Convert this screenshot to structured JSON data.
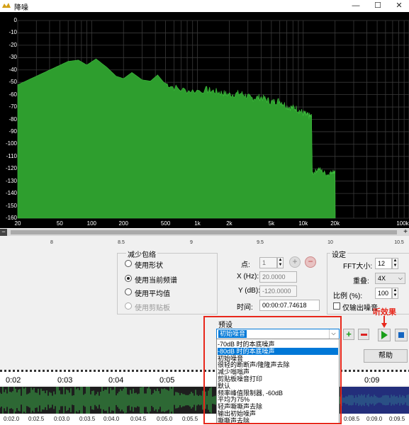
{
  "window": {
    "title": "降噪",
    "controls": [
      "—",
      "☐",
      "✕"
    ]
  },
  "spectrum": {
    "y_labels": [
      "0",
      "-10",
      "-20",
      "-30",
      "-40",
      "-50",
      "-60",
      "-70",
      "-80",
      "-90",
      "-100",
      "-110",
      "-120",
      "-130",
      "-140",
      "-150",
      "-160"
    ],
    "x_labels": [
      "20",
      "50",
      "100",
      "200",
      "500",
      "1k",
      "2k",
      "5k",
      "10k",
      "20k",
      "100k"
    ]
  },
  "ruler": {
    "labels": [
      "8",
      "8.5",
      "9",
      "9.5",
      "10",
      "10.5"
    ]
  },
  "envelope": {
    "title": "减少包络",
    "options": [
      {
        "label": "使用形状",
        "selected": false,
        "disabled": false
      },
      {
        "label": "使用当前频谱",
        "selected": true,
        "disabled": false
      },
      {
        "label": "使用平均值",
        "selected": false,
        "disabled": false
      },
      {
        "label": "使用剪贴板",
        "selected": false,
        "disabled": true
      }
    ]
  },
  "point": {
    "point_label": "点:",
    "point_value": "1",
    "x_label": "X (Hz):",
    "x_value": "20.0000",
    "y_label": "Y (dB):",
    "y_value": "-120.0000",
    "time_label": "时间:",
    "time_value": "00:00:07.74618"
  },
  "settings": {
    "title": "设定",
    "fft_label": "FFT大小:",
    "fft_value": "12",
    "overlap_label": "重叠:",
    "overlap_value": "4X",
    "ratio_label": "比例 (%):",
    "ratio_value": "100",
    "output_noise_label": "仅输出噪音"
  },
  "preset": {
    "title": "预设",
    "selected": "初始噪音",
    "listen_label": "听效果",
    "items": [
      {
        "label": "-70dB 时的本底噪声",
        "selected": false
      },
      {
        "label": "-80dB 时的本底噪声",
        "selected": true
      },
      {
        "label": "初始噪音",
        "selected": false
      },
      {
        "label": "很轻的断断声/隆隆声去除",
        "selected": false
      },
      {
        "label": "减少嗡嗡声",
        "selected": false
      },
      {
        "label": "剪贴板噪音打印",
        "selected": false
      },
      {
        "label": "默认",
        "selected": false
      },
      {
        "label": "频率峰值限制器, -60dB",
        "selected": false
      },
      {
        "label": "平均为75%",
        "selected": false
      },
      {
        "label": "轻声嘶嘶声去除",
        "selected": false
      },
      {
        "label": "输出初始噪声",
        "selected": false
      },
      {
        "label": "嘶嘶声去除",
        "selected": false
      }
    ]
  },
  "buttons": {
    "help": "帮助"
  },
  "timeline": {
    "top_labels": [
      "0:02",
      "0:03",
      "0:04",
      "0:05",
      "0:09"
    ],
    "bottom_labels": [
      "0:02.0",
      "0:02.5",
      "0:03.0",
      "0:03.5",
      "0:04.0",
      "0:04.5",
      "0:05.0",
      "0:05.5",
      "0:08.5",
      "0:09.0",
      "0:09.5"
    ]
  },
  "colors": {
    "spectrum_fill": "#2e9e2e",
    "grid": "#3a3a3a",
    "highlight_box": "#e8271b",
    "selection": "#0078d7",
    "arrow": "#e8271b"
  }
}
